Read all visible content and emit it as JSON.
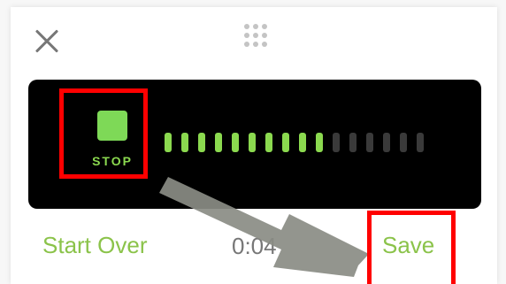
{
  "dialog": {
    "close_icon": "close-icon",
    "drag_icon": "drag-handle-icon"
  },
  "recorder": {
    "stop_label": "STOP",
    "level_meter": {
      "total_segments": 16,
      "active_segments": 10,
      "active_color": "#8bd94f",
      "inactive_color": "#3a3a3a"
    }
  },
  "footer": {
    "start_over_label": "Start Over",
    "timer_text": "0:04",
    "save_label": "Save"
  },
  "colors": {
    "accent": "#8bc34a",
    "highlight": "#ff0000",
    "arrow": "#8a8c84"
  }
}
